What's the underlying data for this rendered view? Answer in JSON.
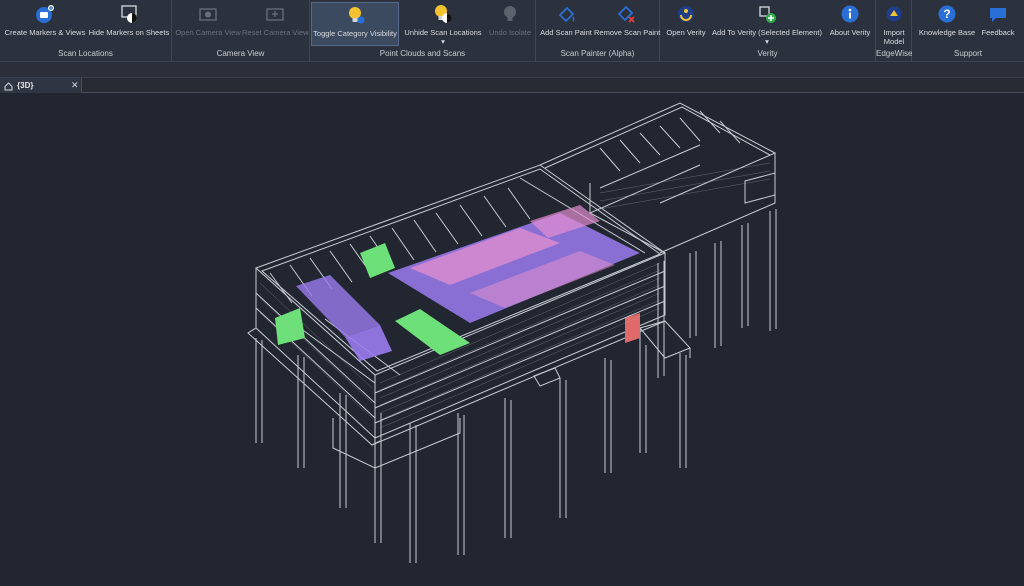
{
  "ribbon": {
    "groups": {
      "scan_locations": "Scan Locations",
      "camera_view": "Camera View",
      "point_clouds": "Point Clouds and Scans",
      "scan_painter": "Scan Painter (Alpha)",
      "verity": "Verity",
      "edgewise": "EdgeWise",
      "support": "Support"
    },
    "buttons": {
      "create_markers": "Create Markers & Views",
      "hide_markers": "Hide Markers on Sheets",
      "open_camera": "Open Camera View",
      "reset_camera": "Reset Camera View",
      "toggle_category": "Toggle Category Visibility",
      "unhide_scan": "Unhide Scan Locations",
      "undo_isolate": "Undo Isolate",
      "add_scan_paint": "Add Scan Paint",
      "remove_scan_paint": "Remove Scan Paint",
      "open_verity": "Open Verity",
      "add_to_verity": "Add To Verity (Selected Element)",
      "about_verity": "About Verity",
      "import_model_1": "Import",
      "import_model_2": "Model",
      "knowledge_base": "Knowledge Base",
      "feedback": "Feedback"
    },
    "dropdown_glyph": "▾"
  },
  "view_tab": {
    "title": "{3D}",
    "close": "✕"
  },
  "colors": {
    "ribbon_bg": "#2c323d",
    "viewport_bg": "#212630",
    "wire": "#c8ccd4",
    "paint_purple": "#9b7cf0",
    "paint_pink": "#e48fd0",
    "paint_green": "#6ee07a",
    "paint_red": "#e06a6a",
    "icon_blue": "#2a6fd6",
    "icon_yellow": "#f2c230"
  }
}
